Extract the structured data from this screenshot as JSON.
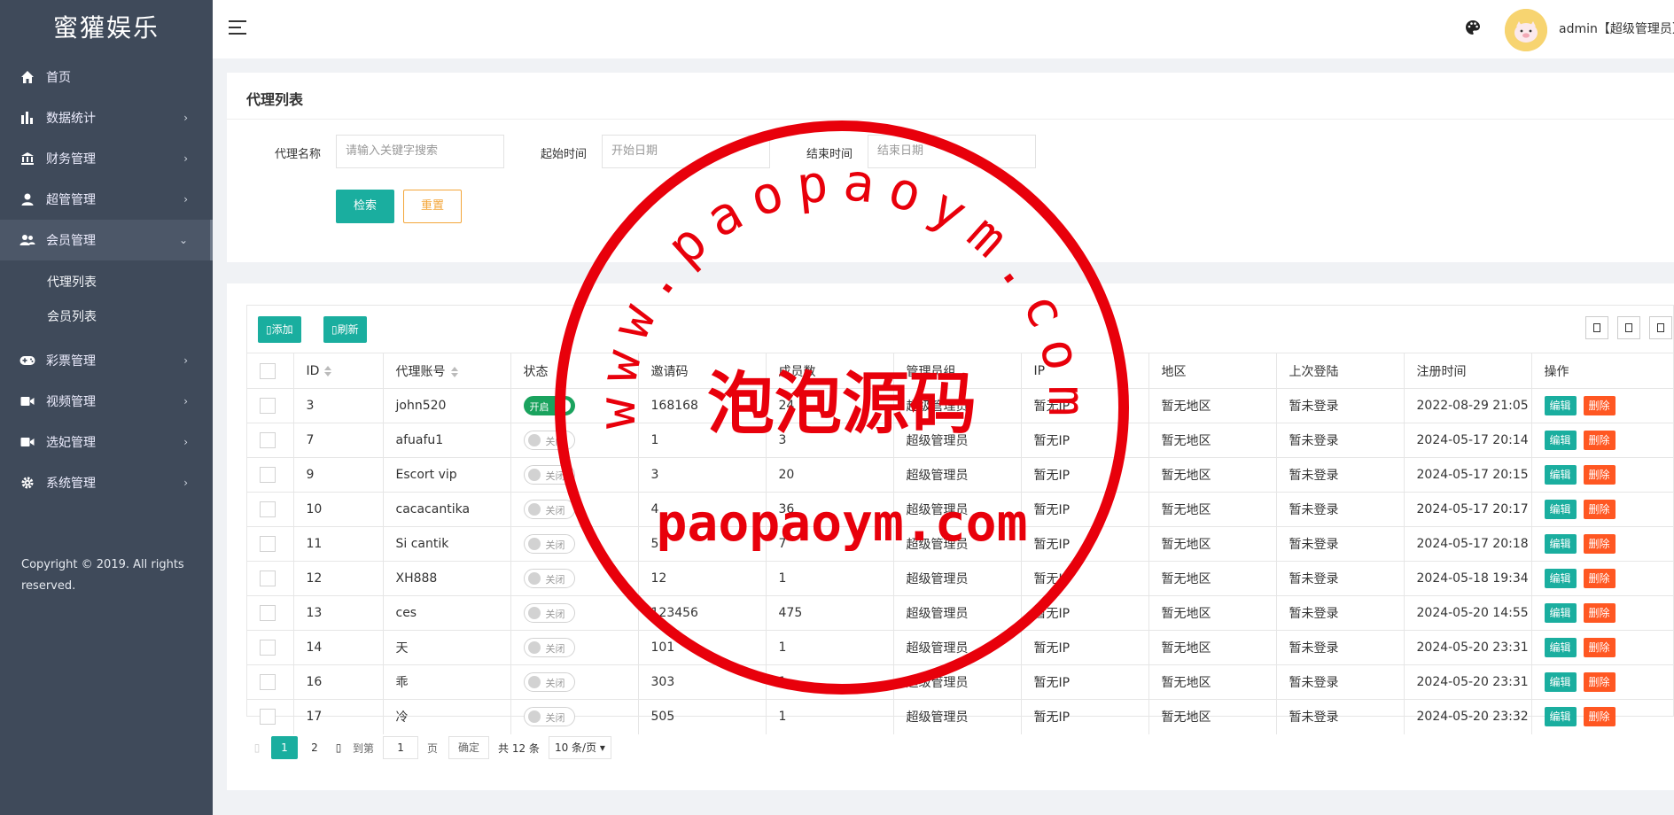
{
  "sidebar": {
    "logo": "蜜獾娱乐",
    "items": [
      {
        "label": "首页",
        "icon": "home-icon",
        "arrow": ""
      },
      {
        "label": "数据统计",
        "icon": "bar-chart-icon",
        "arrow": "›"
      },
      {
        "label": "财务管理",
        "icon": "bank-icon",
        "arrow": "›"
      },
      {
        "label": "超管管理",
        "icon": "user-icon",
        "arrow": "›"
      },
      {
        "label": "会员管理",
        "icon": "users-icon",
        "arrow": "⌄"
      },
      {
        "label": "彩票管理",
        "icon": "gamepad-icon",
        "arrow": "›"
      },
      {
        "label": "视频管理",
        "icon": "video-icon",
        "arrow": "›"
      },
      {
        "label": "选妃管理",
        "icon": "camera-icon",
        "arrow": "›"
      },
      {
        "label": "系统管理",
        "icon": "gear-icon",
        "arrow": "›"
      }
    ],
    "submenu": [
      "代理列表",
      "会员列表"
    ],
    "copyright": "Copyright © 2019. All rights reserved."
  },
  "header": {
    "user": "admin【超级管理员】"
  },
  "search": {
    "title": "代理列表",
    "name_label": "代理名称",
    "name_placeholder": "请输入关键字搜索",
    "start_label": "起始时间",
    "start_placeholder": "开始日期",
    "end_label": "结束时间",
    "end_placeholder": "结束日期",
    "search_btn": "检索",
    "reset_btn": "重置"
  },
  "toolbar": {
    "add": "▯添加",
    "refresh": "▯刷新"
  },
  "table": {
    "headers": [
      "ID",
      "代理账号",
      "状态",
      "邀请码",
      "成员数",
      "管理员组",
      "IP",
      "地区",
      "上次登陆",
      "注册时间",
      "操作"
    ],
    "edit_label": "编辑",
    "delete_label": "删除",
    "switch_on": "开启",
    "switch_off": "关闭",
    "rows": [
      {
        "id": "3",
        "account": "john520",
        "status": true,
        "code": "168168",
        "members": "24",
        "group": "超级管理员",
        "ip": "暂无IP",
        "region": "暂无地区",
        "last": "暂未登录",
        "reg": "2022-08-29 21:05"
      },
      {
        "id": "7",
        "account": "afuafu1",
        "status": false,
        "code": "1",
        "members": "3",
        "group": "超级管理员",
        "ip": "暂无IP",
        "region": "暂无地区",
        "last": "暂未登录",
        "reg": "2024-05-17 20:14"
      },
      {
        "id": "9",
        "account": "Escort vip",
        "status": false,
        "code": "3",
        "members": "20",
        "group": "超级管理员",
        "ip": "暂无IP",
        "region": "暂无地区",
        "last": "暂未登录",
        "reg": "2024-05-17 20:15"
      },
      {
        "id": "10",
        "account": "cacacantika",
        "status": false,
        "code": "4",
        "members": "36",
        "group": "超级管理员",
        "ip": "暂无IP",
        "region": "暂无地区",
        "last": "暂未登录",
        "reg": "2024-05-17 20:17"
      },
      {
        "id": "11",
        "account": "Si cantik",
        "status": false,
        "code": "5",
        "members": "7",
        "group": "超级管理员",
        "ip": "暂无IP",
        "region": "暂无地区",
        "last": "暂未登录",
        "reg": "2024-05-17 20:18"
      },
      {
        "id": "12",
        "account": "XH888",
        "status": false,
        "code": "12",
        "members": "1",
        "group": "超级管理员",
        "ip": "暂无IP",
        "region": "暂无地区",
        "last": "暂未登录",
        "reg": "2024-05-18 19:34"
      },
      {
        "id": "13",
        "account": "ces",
        "status": false,
        "code": "123456",
        "members": "475",
        "group": "超级管理员",
        "ip": "暂无IP",
        "region": "暂无地区",
        "last": "暂未登录",
        "reg": "2024-05-20 14:55"
      },
      {
        "id": "14",
        "account": "天",
        "status": false,
        "code": "101",
        "members": "1",
        "group": "超级管理员",
        "ip": "暂无IP",
        "region": "暂无地区",
        "last": "暂未登录",
        "reg": "2024-05-20 23:31"
      },
      {
        "id": "16",
        "account": "乖",
        "status": false,
        "code": "303",
        "members": "1",
        "group": "超级管理员",
        "ip": "暂无IP",
        "region": "暂无地区",
        "last": "暂未登录",
        "reg": "2024-05-20 23:31"
      },
      {
        "id": "17",
        "account": "冷",
        "status": false,
        "code": "505",
        "members": "1",
        "group": "超级管理员",
        "ip": "暂无IP",
        "region": "暂无地区",
        "last": "暂未登录",
        "reg": "2024-05-20 23:32"
      }
    ]
  },
  "pager": {
    "prev": "▯",
    "current": "1",
    "page2": "2",
    "next": "▯",
    "goto": "到第",
    "goto_value": "1",
    "page_unit": "页",
    "confirm": "确定",
    "total": "共 12 条",
    "size": "10 条/页"
  },
  "watermark": {
    "ring_text": "www.paopaoym.com",
    "center_text": "泡泡源码",
    "bottom_text": "paopaoym.com",
    "color": "#e8000b"
  },
  "colors": {
    "sidebar": "#3f4a5a",
    "accent": "#1aae9f",
    "danger": "#ff5722",
    "warning": "#f3a63a",
    "switch_on": "#1aa35e"
  }
}
